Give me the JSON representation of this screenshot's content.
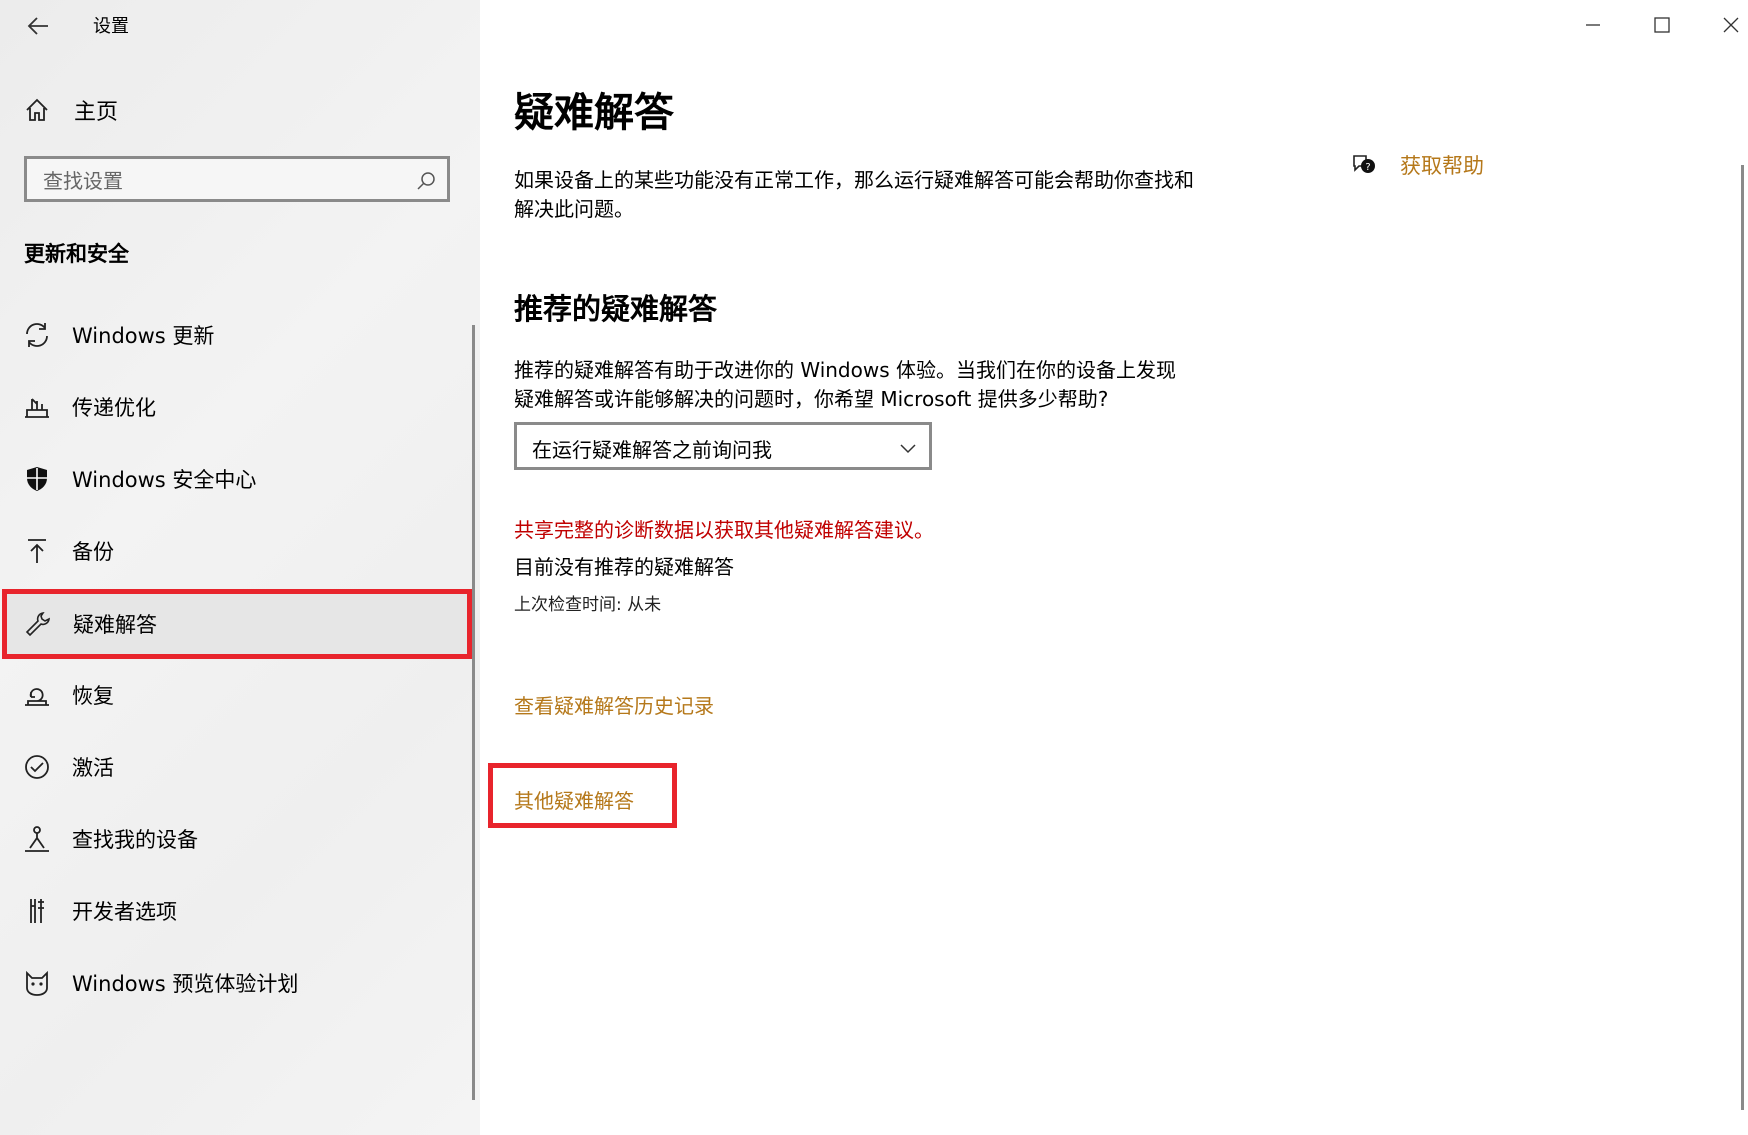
{
  "app": {
    "title": "设置"
  },
  "sidebar": {
    "home_label": "主页",
    "search_placeholder": "查找设置",
    "section_title": "更新和安全",
    "items": [
      {
        "label": "Windows 更新",
        "icon": "refresh-icon"
      },
      {
        "label": "传递优化",
        "icon": "delivery-optimization-icon"
      },
      {
        "label": "Windows 安全中心",
        "icon": "shield-icon"
      },
      {
        "label": "备份",
        "icon": "backup-arrow-icon"
      },
      {
        "label": "疑难解答",
        "icon": "wrench-icon",
        "selected": true
      },
      {
        "label": "恢复",
        "icon": "recovery-icon"
      },
      {
        "label": "激活",
        "icon": "check-circle-icon"
      },
      {
        "label": "查找我的设备",
        "icon": "find-device-icon"
      },
      {
        "label": "开发者选项",
        "icon": "developer-tools-icon"
      },
      {
        "label": "Windows 预览体验计划",
        "icon": "insider-cat-icon"
      }
    ]
  },
  "main": {
    "title": "疑难解答",
    "description": "如果设备上的某些功能没有正常工作，那么运行疑难解答可能会帮助你查找和解决此问题。",
    "help_label": "获取帮助",
    "recommended": {
      "title": "推荐的疑难解答",
      "description": "推荐的疑难解答有助于改进你的 Windows 体验。当我们在你的设备上发现疑难解答或许能够解决的问题时，你希望 Microsoft 提供多少帮助?",
      "dropdown_value": "在运行疑难解答之前询问我",
      "warning": "共享完整的诊断数据以获取其他疑难解答建议。",
      "none_text": "目前没有推荐的疑难解答",
      "last_check": "上次检查时间: 从未"
    },
    "history_link": "查看疑难解答历史记录",
    "other_link": "其他疑难解答"
  },
  "colors": {
    "accent_link": "#b5781a",
    "warning": "#c00000",
    "highlight_border": "#e8242c"
  }
}
